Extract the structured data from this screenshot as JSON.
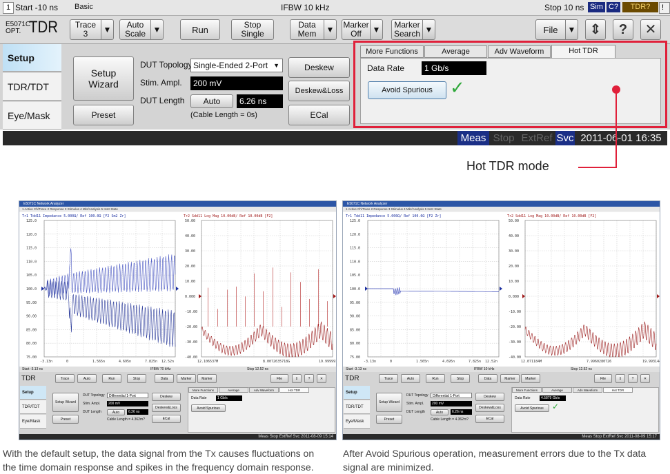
{
  "topbar": {
    "channel": "1",
    "start": "Start -10 ns",
    "ifbw": "IFBW 10 kHz",
    "stop": "Stop 10 ns",
    "sim": "Sim",
    "c_query": "C?",
    "tdr_query": "TDR?",
    "bang": "!"
  },
  "toolbar": {
    "logo_small_1": "E5071C",
    "logo_small_2": "OPT.",
    "logo_big": "TDR",
    "trace_label": "Trace",
    "trace_value": "3",
    "auto_scale_1": "Auto",
    "auto_scale_2": "Scale",
    "run": "Run",
    "stop_single_1": "Stop",
    "stop_single_2": "Single",
    "data_mem_1": "Data",
    "data_mem_2": "Mem",
    "marker_off_1": "Marker",
    "marker_off_2": "Off",
    "marker_search_1": "Marker",
    "marker_search_2": "Search",
    "file": "File",
    "dropdown_arrow": "▼"
  },
  "side_tabs": [
    "Setup",
    "TDR/TDT",
    "Eye/Mask"
  ],
  "basic": {
    "title": "Basic",
    "setup_wizard_1": "Setup",
    "setup_wizard_2": "Wizard",
    "preset": "Preset",
    "dut_topology_label": "DUT Topology",
    "dut_topology_value": "Single-Ended 2-Port",
    "stim_ampl_label": "Stim. Ampl.",
    "stim_ampl_value": "200 mV",
    "dut_length_label": "DUT Length",
    "dut_length_button": "Auto",
    "dut_length_value": "6.26 ns",
    "cable_length": "(Cable Length =  0s)",
    "deskew": "Deskew",
    "deskew_loss": "Deskew&Loss",
    "ecal": "ECal"
  },
  "hot_tdr": {
    "tabs": [
      "More Functions",
      "Average",
      "Adv Waveform",
      "Hot TDR"
    ],
    "data_rate_label": "Data Rate",
    "data_rate_value": "1 Gb/s",
    "avoid_spurious": "Avoid Spurious",
    "check": "✓"
  },
  "status": {
    "meas": "Meas",
    "stop": "Stop",
    "extref": "ExtRef",
    "svc": "Svc",
    "datetime": "2011-06-01 16:35"
  },
  "annotation": "Hot TDR mode",
  "thumbs": [
    {
      "title": "E5071C Network Analyzer",
      "menu": "1 Active Ch/Trace   2 Response   3 Stimulus   4 Mkr/Analysis   5 Instr State",
      "trace1_header": "Tr1 Tdd11 Impedance 5.000Ω/ Ref 100.0Ω [F2 Sm2 Zr]",
      "trace2_header": "Tr2 Sdd11 Log Mag 10.00dB/ Ref 10.00dB [F2]",
      "left_ticks": [
        "125.0",
        "120.0",
        "115.0",
        "110.0",
        "105.0",
        "100.0",
        "95.00",
        "90.00",
        "85.00",
        "80.00",
        "75.00"
      ],
      "right_ticks": [
        "50.00",
        "40.00",
        "30.00",
        "20.00",
        "10.00",
        "0.000",
        "-10.00",
        "-20.00",
        "-30.00",
        "-40.00"
      ],
      "left_x": [
        "-3.13n",
        "0",
        "1.565n",
        "4.695n",
        "7.825n",
        "12.52n"
      ],
      "right_x": [
        "12.106537M",
        "8.0072635718G",
        "19.999991286"
      ],
      "status_left": "Start -3.13 ns",
      "status_mid": "IFBW 70 kHz",
      "status_right": "Stop 12.52 ns",
      "topology": "Differential 1-Port",
      "ampl": "200 mV",
      "length": "6.26 ns",
      "cable": "Cable Length = 4.362m?",
      "data_rate": "1 Gb/s",
      "check": "",
      "footer": "Meas  Stop  ExtRef  Svc  2011-08-09 15:14",
      "caption_1": "With the default setup, the data signal from the Tx causes fluctuations on",
      "caption_2": "the time domain response and spikes in the frequency domain response.",
      "flat": false
    },
    {
      "title": "E5071C Network Analyzer",
      "menu": "1 Active Ch/Trace   2 Response   3 Stimulus   4 Mkr/Analysis   5 Instr State",
      "trace1_header": "Tr1 Tdd11 Impedance 5.000Ω/ Ref 100.0Ω [F2 Zr]",
      "trace2_header": "Tr2 Sdd11 Log Mag 10.00dB/ Ref 10.00dB [F2]",
      "left_ticks": [
        "125.0",
        "120.0",
        "115.0",
        "110.0",
        "105.0",
        "100.0",
        "95.00",
        "90.00",
        "85.00",
        "80.00",
        "75.00"
      ],
      "right_ticks": [
        "50.00",
        "40.00",
        "30.00",
        "20.00",
        "10.00",
        "0.000",
        "-10.00",
        "-20.00",
        "-30.00",
        "-40.00"
      ],
      "left_x": [
        "-3.13n",
        "0",
        "1.565n",
        "4.695n",
        "7.825n",
        "12.52n"
      ],
      "right_x": [
        "12.071184M",
        "7.9960280726",
        "19.9931444996"
      ],
      "status_left": "Start -3.13 ns",
      "status_mid": "IFBW 10 kHz",
      "status_right": "Stop 12.52 ns",
      "topology": "Differential 1-Port",
      "ampl": "200 mV",
      "length": "6.26 ns",
      "cable": "Cable Length = 4.362m?",
      "data_rate": "4.5879 Gb/s",
      "check": "✓",
      "footer": "Meas  Stop  ExtRef  Svc  2011-08-09 15:17",
      "caption_1": "After Avoid Spurious operation, measurement errors due to the Tx data",
      "caption_2": "signal are minimized.",
      "flat": true
    }
  ]
}
